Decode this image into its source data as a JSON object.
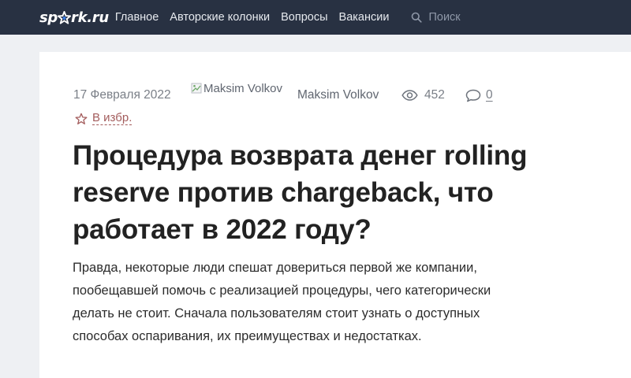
{
  "header": {
    "logo": {
      "left": "sp",
      "right": "rk.ru",
      "star_icon": "star-icon"
    },
    "nav": [
      {
        "label": "Главное"
      },
      {
        "label": "Авторские колонки"
      },
      {
        "label": "Вопросы"
      },
      {
        "label": "Вакансии"
      }
    ],
    "search": {
      "placeholder": "Поиск"
    }
  },
  "article": {
    "date": "17 Февраля 2022",
    "author_image_alt": "Maksim Volkov",
    "author_name": "Maksim Volkov",
    "views": "452",
    "comments": "0",
    "favorite_label": "В избр.",
    "title": "Процедура возврата денег rolling reserve против chargeback, что работает в 2022 году?",
    "lead": "Правда, некоторые люди спешат довериться первой же компании, пообещавшей помочь с реализацией процедуры, чего категорически делать не стоит. Сначала пользователям стоит узнать о доступных способах оспаривания, их преимуществах и недостатках."
  },
  "colors": {
    "topbar": "#283142",
    "star_accent": "#3a7be0",
    "favorite": "#a35c5c",
    "background": "#eef0f3"
  }
}
